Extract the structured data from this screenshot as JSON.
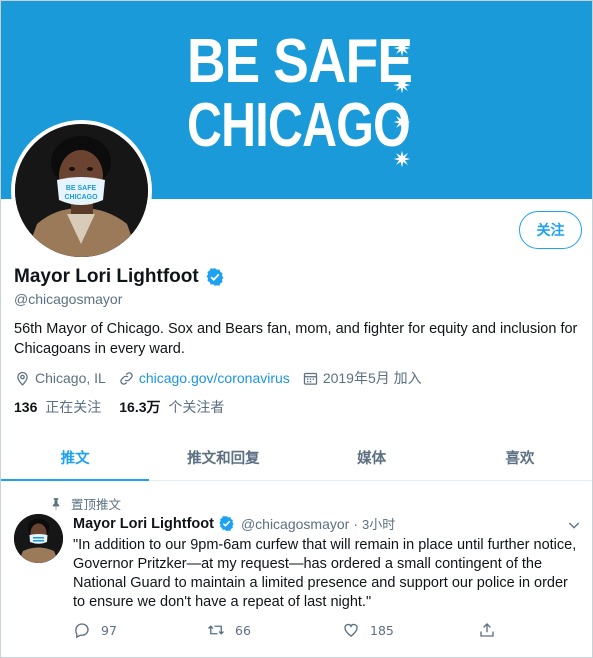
{
  "banner": {
    "line1": "BE SAFE",
    "line2": "CHICAGO",
    "stars": [
      "✷",
      "✷",
      "✷",
      "✷"
    ],
    "background_color": "#1a9ad8"
  },
  "avatar": {
    "mask_text": "BE SAFE CHICAGO"
  },
  "profile": {
    "follow_label": "关注",
    "display_name": "Mayor Lori Lightfoot",
    "handle": "@chicagosmayor",
    "bio": "56th Mayor of Chicago. Sox and Bears fan, mom, and fighter for equity and inclusion for Chicagoans in every ward.",
    "location": "Chicago, IL",
    "link": "chicago.gov/coronavirus",
    "joined": "2019年5月 加入",
    "following_count": "136",
    "following_label": "正在关注",
    "followers_count": "16.3万",
    "followers_label": "个关注者",
    "accent_color": "#1da1f2"
  },
  "tabs": [
    {
      "label": "推文",
      "active": true
    },
    {
      "label": "推文和回复",
      "active": false
    },
    {
      "label": "媒体",
      "active": false
    },
    {
      "label": "喜欢",
      "active": false
    }
  ],
  "tweet": {
    "pinned_label": "置顶推文",
    "author_name": "Mayor Lori Lightfoot",
    "author_handle": "@chicagosmayor",
    "separator": "·",
    "time": "3小时",
    "text": "\"In addition to our 9pm-6am curfew that will remain in place until further notice, Governor Pritzker—at my request—has ordered a small contingent of the National Guard to maintain a limited presence and support our police in order to ensure we don't have a repeat of last night.\"",
    "replies": "97",
    "retweets": "66",
    "likes": "185"
  }
}
